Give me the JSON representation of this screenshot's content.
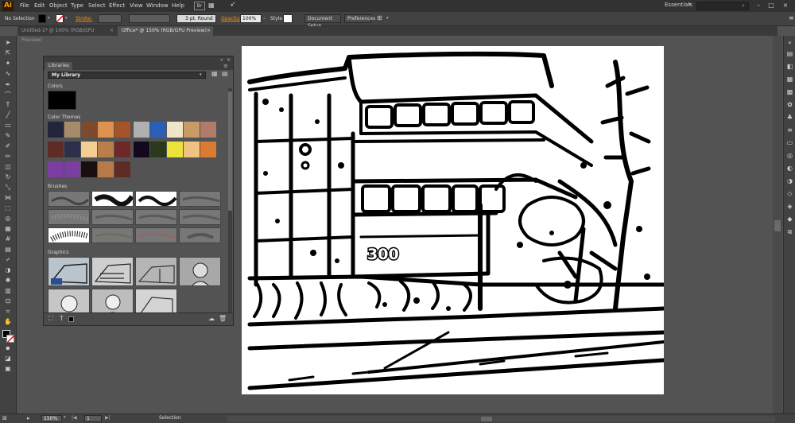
{
  "app": {
    "logo": "Ai",
    "menus": [
      "File",
      "Edit",
      "Object",
      "Type",
      "Select",
      "Effect",
      "View",
      "Window",
      "Help"
    ],
    "workspace": "Essentials"
  },
  "control": {
    "selection": "No Selection",
    "stroke_label": "Stroke:",
    "brush_value": "3 pt. Round",
    "opacity_label": "Opacity:",
    "opacity_value": "100%",
    "style_label": "Style:",
    "document_setup": "Document Setup",
    "preferences": "Preferences",
    "accent": "#ff8c00"
  },
  "tabs": [
    {
      "label": "Untitled-1* @ 100% (RGB/GPU Preview)",
      "close": "×"
    },
    {
      "label": "Office* @ 150% (RGB/GPU Preview)",
      "close": "×"
    }
  ],
  "libraries": {
    "panel_title": "Libraries",
    "library_name": "My Library",
    "sections": {
      "colors": "Colors",
      "color_themes": "Color Themes",
      "brushes": "Brushes",
      "graphics": "Graphics"
    },
    "colors": [
      "#000000"
    ],
    "theme_swatches": [
      [
        "#23253a",
        "#a58b6a",
        "#7e4a2e",
        "#de9150",
        "#a5542a"
      ],
      [
        "#b0b0b0",
        "#2a5fb8",
        "#efe5c8",
        "#c79a66",
        "#b07b68"
      ],
      [
        "#5e2c24",
        "#2e2f4b",
        "#f3cd92",
        "#b97f4b",
        "#6f2828"
      ],
      [
        "#14091c",
        "#29391b",
        "#ebe33a",
        "#f0c282",
        "#db7a31"
      ],
      [
        "#7a3fa0",
        "#7a3fa0",
        "#1a0f0f",
        "#b87a48",
        "#5e2c24"
      ]
    ]
  },
  "artboard": {
    "sign_text": "300"
  },
  "status": {
    "zoom": "150%",
    "page": "1",
    "tool": "Selection"
  }
}
